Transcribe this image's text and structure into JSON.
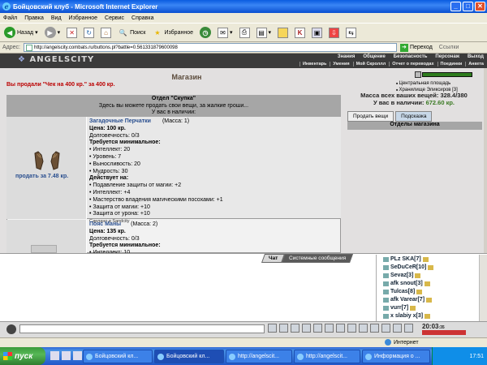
{
  "window": {
    "title": "Бойцовский клуб - Microsoft Internet Explorer"
  },
  "menu": [
    "Файл",
    "Правка",
    "Вид",
    "Избранное",
    "Сервис",
    "Справка"
  ],
  "toolbar": {
    "back": "Назад",
    "search": "Поиск",
    "favorites": "Избранное"
  },
  "address": {
    "label": "Адрес:",
    "url": "http://angelscity.combats.ru/buttons.pl?battle=0.561331879600098",
    "go": "Переход",
    "links": "Ссылки"
  },
  "site": {
    "logo": "ANGELSCITY",
    "nav": [
      "Знания",
      "Общение",
      "Безопасность",
      "Персонаж",
      "Выход"
    ],
    "subnav": [
      "Инвентарь",
      "Умения",
      "Мой Скроллл",
      "Отчет о переводах",
      "Поединки",
      "Анкета"
    ]
  },
  "shop": {
    "title": "Магазин",
    "sold_message": "Вы продали \"Чек на 400 кр.\" за 400 кр.",
    "dept_title": "Отдел \"Скупка\"",
    "dept_desc": "Здесь вы можете продать свои вещи, за жалкие гроши...",
    "dept_have": "У вас в наличии:"
  },
  "item1": {
    "name": "Загадочные Перчатки",
    "mass": "(Масса: 1)",
    "price": "Цена: 100 кр.",
    "durability": "Долговечность: 0/3",
    "req_title": "Требуется минимальное:",
    "reqs": [
      "• Интеллект: 20",
      "• Уровень: 7",
      "• Выносливость: 20",
      "• Мудрость: 30"
    ],
    "acts_title": "Действует на:",
    "acts": [
      "• Подавление защиты от магии: +2",
      "• Интеллект: +4",
      "• Мастерство владения магическими посохами: +1",
      "• Защита от магии: +10",
      "• Защита от урона: +10"
    ],
    "signature": "Сделано в Sandcity",
    "sell": "продать за 7.48 кр."
  },
  "item2": {
    "name": "Пояс Маны",
    "mass": "(Масса: 2)",
    "price": "Цена: 135 кр.",
    "durability": "Долговечность: 0/3",
    "req_title": "Требуется минимальное:",
    "req_partial": "• Интеллект: 10"
  },
  "side": {
    "locations": [
      "Центральная площадь",
      "Хранилище Эликсиров [3]"
    ],
    "total_weight": "Масса всех ваших вещей: 328.4/380",
    "cash_label": "У вас в наличии:",
    "cash_value": "672.60 кр.",
    "tab_sell": "Продать вещи",
    "tab_hint": "Подсказка",
    "section": "Отделы магазина"
  },
  "chat": {
    "tab_chat": "Чат",
    "tab_system": "Системные сообщения",
    "users": [
      "PLz SKA[7]",
      "SeDuCeR[10]",
      "Sevaz[3]",
      "afk snout[3]",
      "Tulcas[8]",
      "afk Varear[7]",
      "vurr[7]",
      "x slabiy x[3]"
    ]
  },
  "bottom": {
    "clock": "20:03",
    "clock_suffix": ":35"
  },
  "statusbar": {
    "zone": "Интернет"
  },
  "taskbar": {
    "start": "пуск",
    "tasks": [
      "Бойцовский кл...",
      "Бойцовский кл...",
      "http://angelscit...",
      "http://angelscit...",
      "Информация о ..."
    ],
    "time": "17:51"
  }
}
